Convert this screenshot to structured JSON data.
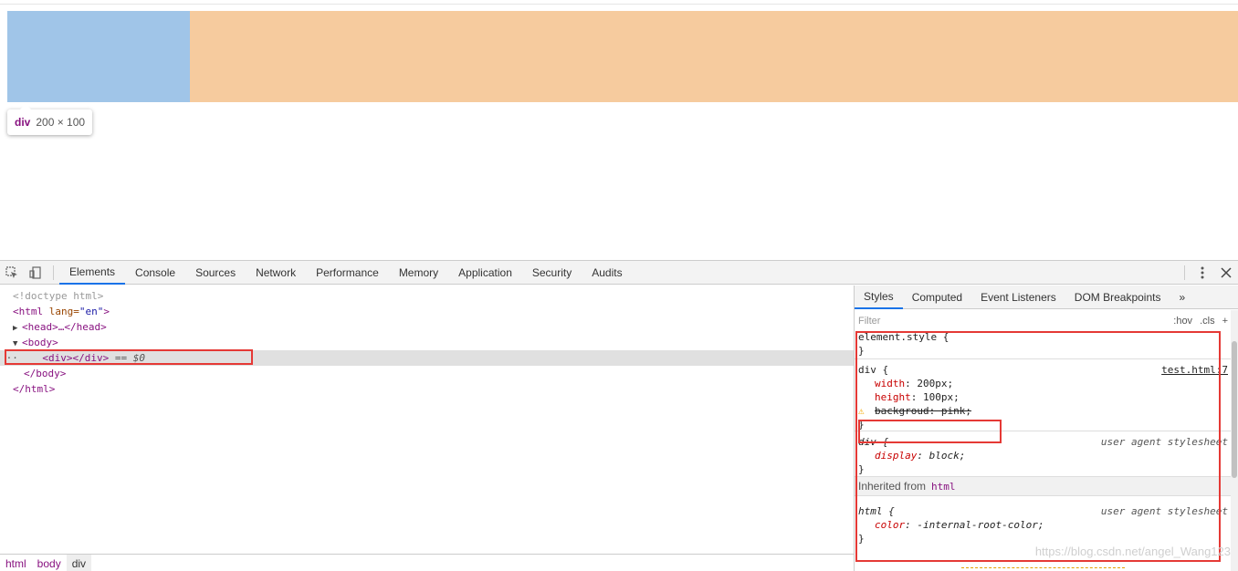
{
  "viewport": {
    "tooltip": {
      "tag": "div",
      "dimensions": "200 × 100"
    }
  },
  "devtools": {
    "tabs": [
      "Elements",
      "Console",
      "Sources",
      "Network",
      "Performance",
      "Memory",
      "Application",
      "Security",
      "Audits"
    ],
    "active_tab": "Elements",
    "icons": {
      "inspect": "inspect-element-icon",
      "device": "device-toolbar-icon",
      "more": "more-vertical-icon",
      "close": "close-icon"
    }
  },
  "elements": {
    "doctype": "<!doctype html>",
    "html_open": "<html",
    "html_attr": " lang=",
    "html_attr_val": "\"en\"",
    "html_close_bracket": ">",
    "head": "<head>…</head>",
    "body_open": "<body>",
    "div": "<div></div>",
    "div_suffix": " == $0",
    "body_close": "</body>",
    "html_close": "</html>",
    "breadcrumbs": [
      "html",
      "body",
      "div"
    ]
  },
  "styles": {
    "tabs": [
      "Styles",
      "Computed",
      "Event Listeners",
      "DOM Breakpoints",
      "»"
    ],
    "filter_placeholder": "Filter",
    "hov": ":hov",
    "cls": ".cls",
    "plus": "+",
    "element_style": "element.style {",
    "close_brace": "}",
    "rule1": {
      "selector": "div {",
      "source": "test.html:7",
      "props": [
        {
          "name": "width",
          "value": "200px;"
        },
        {
          "name": "height",
          "value": "100px;"
        },
        {
          "name": "backgroud",
          "value": "pink;"
        }
      ]
    },
    "rule2": {
      "selector": "div {",
      "source": "user agent stylesheet",
      "props": [
        {
          "name": "display",
          "value": "block;"
        }
      ]
    },
    "inherited_label": "Inherited from",
    "inherited_tag": "html",
    "rule3": {
      "selector": "html {",
      "source": "user agent stylesheet",
      "props": [
        {
          "name": "color",
          "value": "-internal-root-color;"
        }
      ]
    }
  },
  "watermark": "https://blog.csdn.net/angel_Wang123"
}
